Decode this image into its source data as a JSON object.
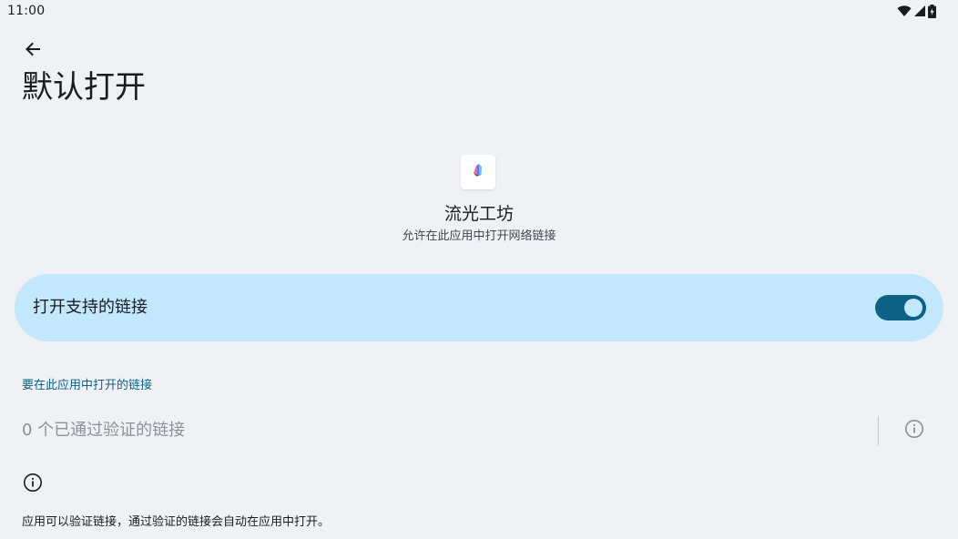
{
  "status_bar": {
    "time": "11:00",
    "icons": [
      "wifi-icon",
      "cellular-signal-icon",
      "battery-charging-icon"
    ]
  },
  "header": {
    "back_icon": "arrow-left-icon",
    "title": "默认打开"
  },
  "app": {
    "icon": "app-logo-icon",
    "name": "流光工坊",
    "subtitle": "允许在此应用中打开网络链接"
  },
  "open_supported_links": {
    "label": "打开支持的链接",
    "enabled": true
  },
  "links_section": {
    "header": "要在此应用中打开的链接",
    "verified_links_label": "0 个已通过验证的链接",
    "info_icon": "info-outline-icon"
  },
  "footer": {
    "info_icon": "info-outline-icon",
    "text": "应用可以验证链接，通过验证的链接会自动在应用中打开。"
  },
  "colors": {
    "background": "#f0f1f5",
    "card": "#c3e7fc",
    "accent": "#0d6185",
    "secondary_text": "#8e9099"
  }
}
